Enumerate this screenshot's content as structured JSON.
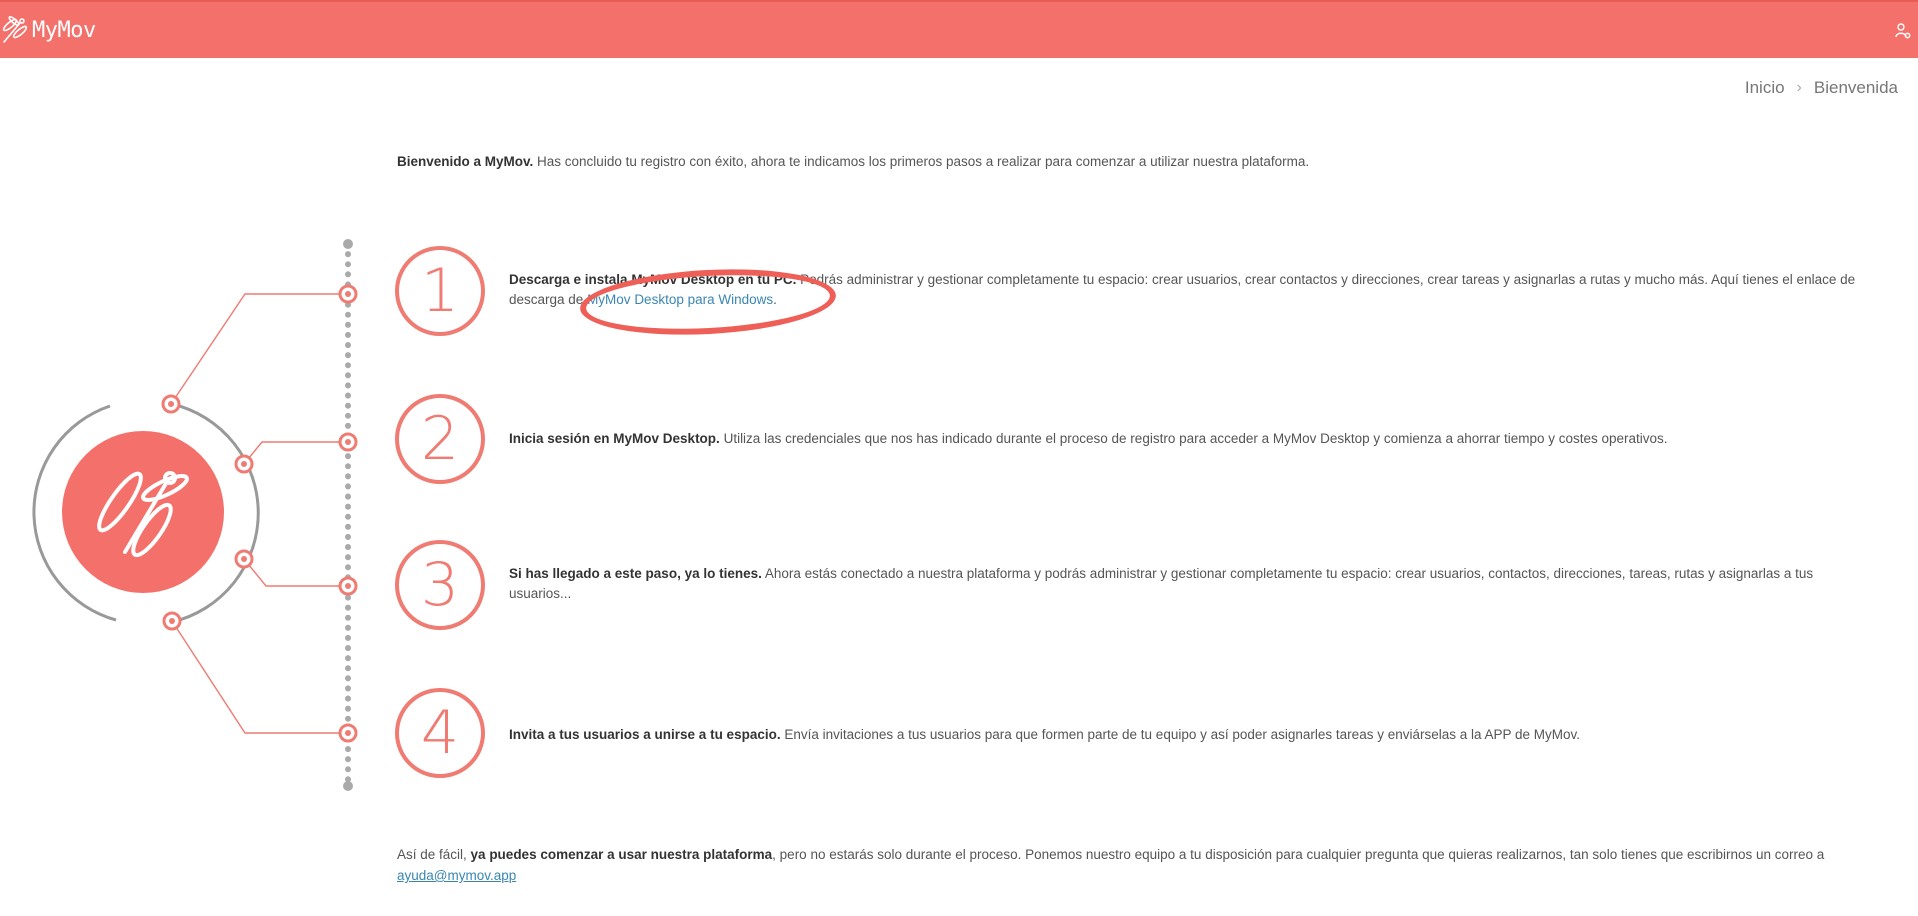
{
  "header": {
    "logo_text": "MyMov",
    "user_icon": "user-settings-icon",
    "brand_color": "#f3716a"
  },
  "breadcrumb": {
    "home": "Inicio",
    "current": "Bienvenida"
  },
  "welcome": {
    "bold": "Bienvenido a MyMov.",
    "text": " Has concluido tu registro con éxito, ahora te indicamos los primeros pasos a realizar para comenzar a utilizar nuestra plataforma."
  },
  "steps": [
    {
      "number": "1",
      "bold": "Descarga e instala MyMov Desktop en tu PC.",
      "text": " Podrás administrar y gestionar completamente tu espacio: crear usuarios, crear contactos y direcciones, crear tareas y asignarlas a rutas y mucho más. Aquí tienes el enlace de descarga de ",
      "link": "MyMov Desktop para Windows",
      "after": "."
    },
    {
      "number": "2",
      "bold": "Inicia sesión en MyMov Desktop.",
      "text": " Utiliza las credenciales que nos has indicado durante el proceso de registro para acceder a MyMov Desktop y comienza a ahorrar tiempo y costes operativos."
    },
    {
      "number": "3",
      "bold": "Si has llegado a este paso, ya lo tienes.",
      "text": " Ahora estás conectado a nuestra plataforma y podrás administrar y gestionar completamente tu espacio: crear usuarios, contactos, direcciones, tareas, rutas y asignarlas a tus usuarios..."
    },
    {
      "number": "4",
      "bold": "Invita a tus usuarios a unirse a tu espacio.",
      "text": " Envía invitaciones a tus usuarios para que formen parte de tu equipo y así poder asignarles tareas y enviárselas a la APP de MyMov."
    }
  ],
  "footer": {
    "pre": "Así de fácil, ",
    "bold": "ya puedes comenzar a usar nuestra plataforma",
    "text": ", pero no estarás solo durante el proceso. Ponemos nuestro equipo a tu disposición para cualquier pregunta que quieras realizarnos, tan solo tienes que escribirnos un correo a ",
    "email": "ayuda@mymov.app"
  }
}
